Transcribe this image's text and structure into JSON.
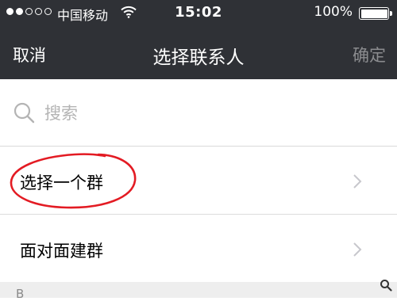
{
  "status_bar": {
    "carrier": "中国移动",
    "time": "15:02",
    "battery_pct": "100%",
    "battery_level": 1.0,
    "signal_filled": 2,
    "signal_total": 5
  },
  "nav": {
    "cancel_label": "取消",
    "title": "选择联系人",
    "confirm_label": "确定"
  },
  "search": {
    "placeholder": "搜索",
    "value": ""
  },
  "options": [
    {
      "label": "选择一个群"
    },
    {
      "label": "面对面建群"
    }
  ],
  "section_header": {
    "letter": "B"
  },
  "annotation": {
    "color": "#e31b23"
  },
  "colors": {
    "header_bg": "#2f3136",
    "confirm_disabled": "#8b8c8f"
  },
  "icons": {
    "wifi": "wifi-icon",
    "search": "search-icon",
    "chevron": "chevron-right-icon",
    "index_search": "index-search-icon"
  }
}
